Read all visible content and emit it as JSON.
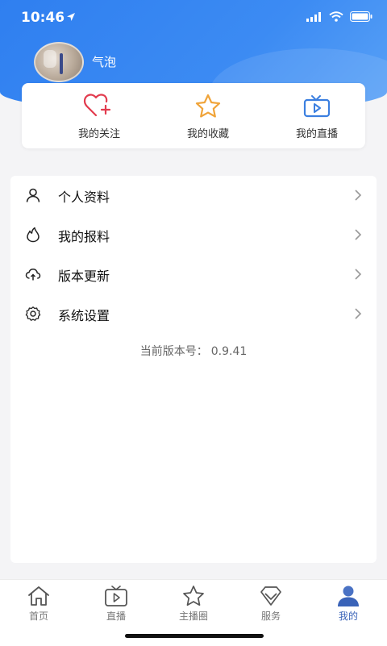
{
  "status_bar": {
    "time": "10:46"
  },
  "profile": {
    "username": "气泡"
  },
  "quick_actions": [
    {
      "label": "我的关注",
      "icon": "heart-plus-icon"
    },
    {
      "label": "我的收藏",
      "icon": "star-icon"
    },
    {
      "label": "我的直播",
      "icon": "tv-icon"
    }
  ],
  "menu": [
    {
      "label": "个人资料",
      "icon": "user-icon"
    },
    {
      "label": "我的报料",
      "icon": "flame-icon"
    },
    {
      "label": "版本更新",
      "icon": "cloud-upload-icon"
    },
    {
      "label": "系统设置",
      "icon": "gear-icon"
    }
  ],
  "version": {
    "label": "当前版本号：",
    "number": "0.9.41"
  },
  "tabs": [
    {
      "label": "首页",
      "icon": "home-icon",
      "active": false
    },
    {
      "label": "直播",
      "icon": "tv-icon",
      "active": false
    },
    {
      "label": "主播圈",
      "icon": "star-icon",
      "active": false
    },
    {
      "label": "服务",
      "icon": "diamond-icon",
      "active": false
    },
    {
      "label": "我的",
      "icon": "user-avatar-icon",
      "active": true
    }
  ],
  "colors": {
    "header_blue": "#2f7ff0",
    "accent_red": "#e23b4e",
    "accent_orange": "#f0a43a",
    "accent_blue": "#3b7fe0",
    "tab_active": "#3a63b8"
  }
}
